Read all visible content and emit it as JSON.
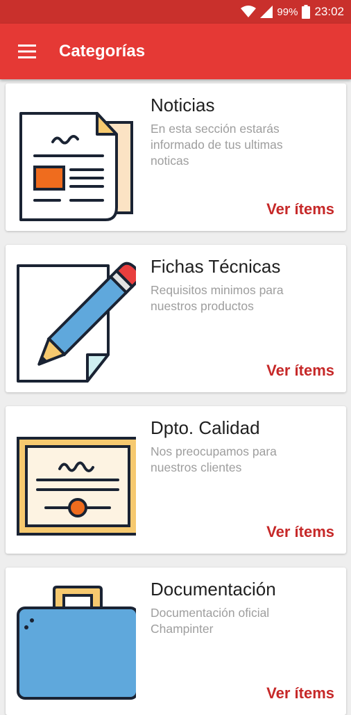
{
  "status_bar": {
    "battery": "99%",
    "time": "23:02",
    "icons": [
      "wifi-icon",
      "signal-icon",
      "battery-icon"
    ]
  },
  "app_bar": {
    "title": "Categorías",
    "menu_icon": "hamburger-menu-icon"
  },
  "colors": {
    "status_bar": "#c9302c",
    "app_bar": "#e53935",
    "action": "#c62828"
  },
  "categories": [
    {
      "title": "Noticias",
      "description": "En esta sección estarás informado de tus ultimas noticas",
      "action": "Ver ítems",
      "icon": "newspaper-icon"
    },
    {
      "title": "Fichas Técnicas",
      "description": "Requisitos minimos para nuestros productos",
      "action": "Ver ítems",
      "icon": "pencil-document-icon"
    },
    {
      "title": "Dpto. Calidad",
      "description": "Nos preocupamos para nuestros clientes",
      "action": "Ver ítems",
      "icon": "certificate-icon"
    },
    {
      "title": "Documentación",
      "description": "Documentación oficial Champinter",
      "action": "Ver ítems",
      "icon": "briefcase-icon"
    }
  ]
}
